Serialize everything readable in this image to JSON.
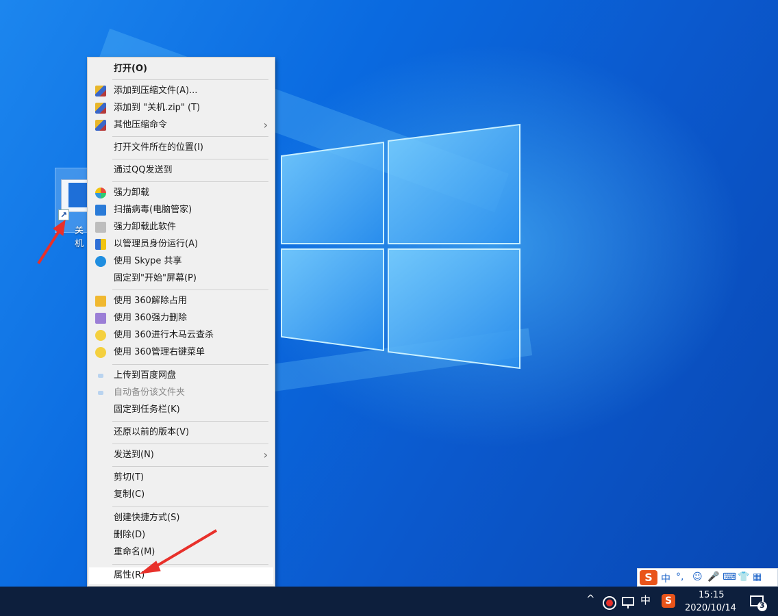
{
  "desktop": {
    "shortcut_label": "关机"
  },
  "context_menu": {
    "items": [
      {
        "label": "打开(O)",
        "bold": true
      },
      {
        "label": "添加到压缩文件(A)...",
        "icon": "archive-icon"
      },
      {
        "label": "添加到 \"关机.zip\" (T)",
        "icon": "archive-icon"
      },
      {
        "label": "其他压缩命令",
        "icon": "archive-icon",
        "submenu": true
      },
      {
        "label": "打开文件所在的位置(I)"
      },
      {
        "label": "通过QQ发送到"
      },
      {
        "label": "强力卸载",
        "icon": "clover-icon"
      },
      {
        "label": "扫描病毒(电脑管家)",
        "icon": "shield-scan-icon"
      },
      {
        "label": "强力卸载此软件",
        "icon": "trash-icon"
      },
      {
        "label": "以管理员身份运行(A)",
        "icon": "uac-shield-icon"
      },
      {
        "label": "使用 Skype 共享",
        "icon": "skype-icon"
      },
      {
        "label": "固定到\"开始\"屏幕(P)"
      },
      {
        "label": "使用 360解除占用",
        "icon": "folder-unlock-icon"
      },
      {
        "label": "使用 360强力删除",
        "icon": "shredder-icon"
      },
      {
        "label": "使用 360进行木马云查杀",
        "icon": "360-plus-icon"
      },
      {
        "label": "使用 360管理右键菜单",
        "icon": "360-plus-icon"
      },
      {
        "label": "上传到百度网盘",
        "icon": "cloud-icon"
      },
      {
        "label": "自动备份该文件夹",
        "icon": "cloud-icon",
        "disabled": true
      },
      {
        "label": "固定到任务栏(K)"
      },
      {
        "label": "还原以前的版本(V)"
      },
      {
        "label": "发送到(N)",
        "submenu": true
      },
      {
        "label": "剪切(T)"
      },
      {
        "label": "复制(C)"
      },
      {
        "label": "创建快捷方式(S)"
      },
      {
        "label": "删除(D)"
      },
      {
        "label": "重命名(M)"
      },
      {
        "label": "属性(R)",
        "hover": true
      }
    ],
    "submenu_glyph": "›"
  },
  "ime_bar": {
    "logo": "S",
    "mode": "中",
    "punct": "°,",
    "emoji": "☺",
    "mic": "🎤",
    "keyboard": "⌨",
    "skin": "👕",
    "grid": "▦"
  },
  "taskbar": {
    "tray_chevron": "^",
    "ime_mode": "中",
    "sogou": "S",
    "time": "15:15",
    "date": "2020/10/14",
    "notification_count": "3"
  },
  "colors": {
    "accent_red": "#e8302a",
    "menu_bg": "#f0f0f0",
    "taskbar_bg": "#0d1f3d"
  }
}
